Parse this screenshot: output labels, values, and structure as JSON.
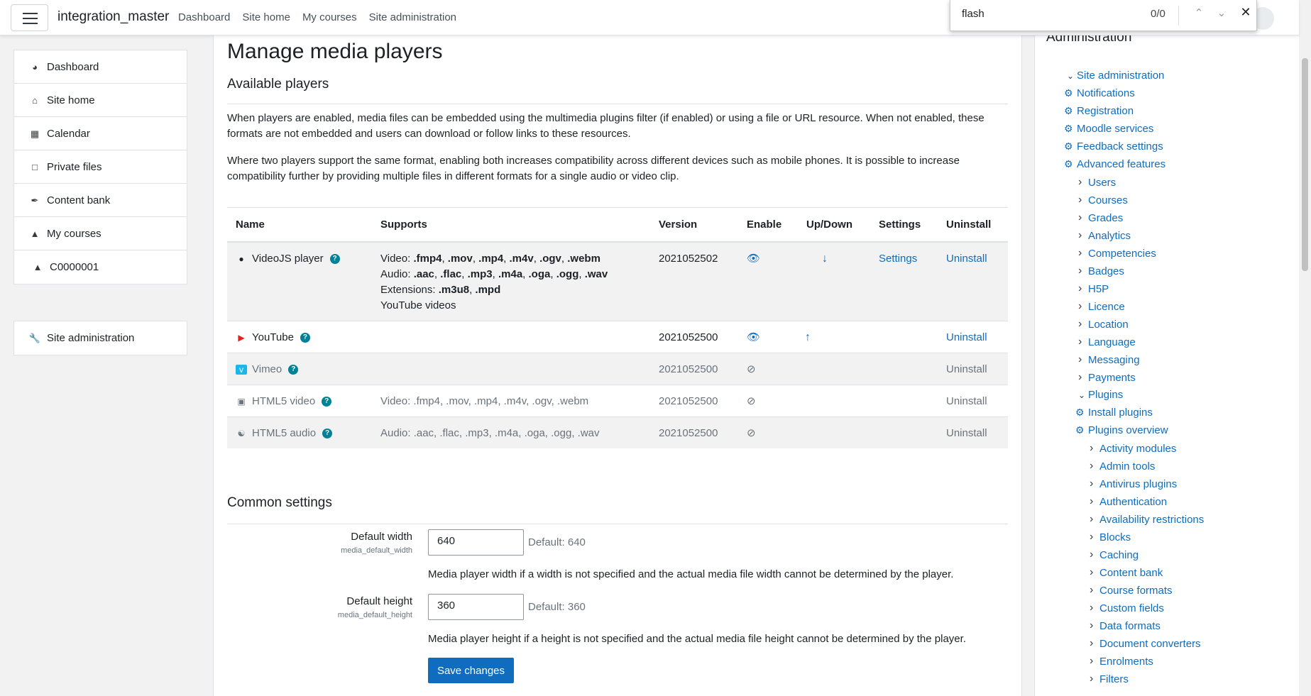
{
  "navbar": {
    "brand": "integration_master",
    "links": [
      "Dashboard",
      "Site home",
      "My courses",
      "Site administration"
    ]
  },
  "findbar": {
    "query": "flash",
    "count": "0/0",
    "up_icon": "chevron-up-icon",
    "down_icon": "chevron-down-icon",
    "close_icon": "close-icon"
  },
  "leftnav": {
    "items": [
      {
        "label": "Dashboard",
        "icon": "dashboard-icon"
      },
      {
        "label": "Site home",
        "icon": "home-icon"
      },
      {
        "label": "Calendar",
        "icon": "calendar-icon"
      },
      {
        "label": "Private files",
        "icon": "file-icon"
      },
      {
        "label": "Content bank",
        "icon": "brush-icon"
      },
      {
        "label": "My courses",
        "icon": "graduation-cap-icon"
      },
      {
        "label": "C0000001",
        "icon": "graduation-cap-icon"
      }
    ],
    "admin": {
      "label": "Site administration",
      "icon": "wrench-icon"
    }
  },
  "main": {
    "title": "Manage media players",
    "available_heading": "Available players",
    "para1": "When players are enabled, media files can be embedded using the multimedia plugins filter (if enabled) or using a file or URL resource. When not enabled, these formats are not embedded and users can download or follow links to these resources.",
    "para2": "Where two players support the same format, enabling both increases compatibility across different devices such as mobile phones. It is possible to increase compatibility further by providing multiple files in different formats for a single audio or video clip.",
    "table": {
      "headers": [
        "Name",
        "Supports",
        "Version",
        "Enable",
        "Up/Down",
        "Settings",
        "Uninstall"
      ],
      "rows": [
        {
          "name": "VideoJS player",
          "icon": "videojs-icon",
          "supports_video_label": "Video: ",
          "supports_video": [
            ".fmp4",
            ".mov",
            ".mp4",
            ".m4v",
            ".ogv",
            ".webm"
          ],
          "supports_audio_label": "Audio: ",
          "supports_audio": [
            ".aac",
            ".flac",
            ".mp3",
            ".m4a",
            ".oga",
            ".ogg",
            ".wav"
          ],
          "supports_ext_label": "Extensions: ",
          "supports_ext": [
            ".m3u8",
            ".mpd"
          ],
          "supports_extra": "YouTube videos",
          "version": "2021052502",
          "enabled": true,
          "move": "down",
          "settings": "Settings",
          "uninstall": "Uninstall"
        },
        {
          "name": "YouTube",
          "icon": "youtube-icon",
          "supports": "",
          "version": "2021052500",
          "enabled": true,
          "move": "up",
          "settings": "",
          "uninstall": "Uninstall"
        },
        {
          "name": "Vimeo",
          "icon": "vimeo-icon",
          "supports": "",
          "version": "2021052500",
          "enabled": false,
          "move": "",
          "settings": "",
          "uninstall": "Uninstall"
        },
        {
          "name": "HTML5 video",
          "icon": "video-camera-icon",
          "supports": "Video: .fmp4, .mov, .mp4, .m4v, .ogv, .webm",
          "version": "2021052500",
          "enabled": false,
          "move": "",
          "settings": "",
          "uninstall": "Uninstall"
        },
        {
          "name": "HTML5 audio",
          "icon": "headphones-icon",
          "supports": "Audio: .aac, .flac, .mp3, .m4a, .oga, .ogg, .wav",
          "version": "2021052500",
          "enabled": false,
          "move": "",
          "settings": "",
          "uninstall": "Uninstall"
        }
      ]
    },
    "common_heading": "Common settings",
    "width": {
      "label": "Default width",
      "sub": "media_default_width",
      "value": "640",
      "default": "Default: 640",
      "desc": "Media player width if a width is not specified and the actual media file width cannot be determined by the player."
    },
    "height": {
      "label": "Default height",
      "sub": "media_default_height",
      "value": "360",
      "default": "Default: 360",
      "desc": "Media player height if a height is not specified and the actual media file height cannot be determined by the player."
    },
    "save": "Save changes"
  },
  "admin": {
    "heading": "Administration",
    "tree": [
      {
        "label": "Site administration",
        "type": "expanded",
        "level": 0
      },
      {
        "label": "Notifications",
        "type": "gear",
        "level": 0
      },
      {
        "label": "Registration",
        "type": "gear",
        "level": 0
      },
      {
        "label": "Moodle services",
        "type": "gear",
        "level": 0
      },
      {
        "label": "Feedback settings",
        "type": "gear",
        "level": 0
      },
      {
        "label": "Advanced features",
        "type": "gear",
        "level": 0
      },
      {
        "label": "Users",
        "type": "collapsed",
        "level": 1
      },
      {
        "label": "Courses",
        "type": "collapsed",
        "level": 1
      },
      {
        "label": "Grades",
        "type": "collapsed",
        "level": 1
      },
      {
        "label": "Analytics",
        "type": "collapsed",
        "level": 1
      },
      {
        "label": "Competencies",
        "type": "collapsed",
        "level": 1
      },
      {
        "label": "Badges",
        "type": "collapsed",
        "level": 1
      },
      {
        "label": "H5P",
        "type": "collapsed",
        "level": 1
      },
      {
        "label": "Licence",
        "type": "collapsed",
        "level": 1
      },
      {
        "label": "Location",
        "type": "collapsed",
        "level": 1
      },
      {
        "label": "Language",
        "type": "collapsed",
        "level": 1
      },
      {
        "label": "Messaging",
        "type": "collapsed",
        "level": 1
      },
      {
        "label": "Payments",
        "type": "collapsed",
        "level": 1
      },
      {
        "label": "Plugins",
        "type": "expanded",
        "level": 1
      },
      {
        "label": "Install plugins",
        "type": "gear",
        "level": 1
      },
      {
        "label": "Plugins overview",
        "type": "gear",
        "level": 1
      },
      {
        "label": "Activity modules",
        "type": "collapsed",
        "level": 2
      },
      {
        "label": "Admin tools",
        "type": "collapsed",
        "level": 2
      },
      {
        "label": "Antivirus plugins",
        "type": "collapsed",
        "level": 2
      },
      {
        "label": "Authentication",
        "type": "collapsed",
        "level": 2
      },
      {
        "label": "Availability restrictions",
        "type": "collapsed",
        "level": 2
      },
      {
        "label": "Blocks",
        "type": "collapsed",
        "level": 2
      },
      {
        "label": "Caching",
        "type": "collapsed",
        "level": 2
      },
      {
        "label": "Content bank",
        "type": "collapsed",
        "level": 2
      },
      {
        "label": "Course formats",
        "type": "collapsed",
        "level": 2
      },
      {
        "label": "Custom fields",
        "type": "collapsed",
        "level": 2
      },
      {
        "label": "Data formats",
        "type": "collapsed",
        "level": 2
      },
      {
        "label": "Document converters",
        "type": "collapsed",
        "level": 2
      },
      {
        "label": "Enrolments",
        "type": "collapsed",
        "level": 2
      },
      {
        "label": "Filters",
        "type": "collapsed",
        "level": 2
      }
    ]
  }
}
